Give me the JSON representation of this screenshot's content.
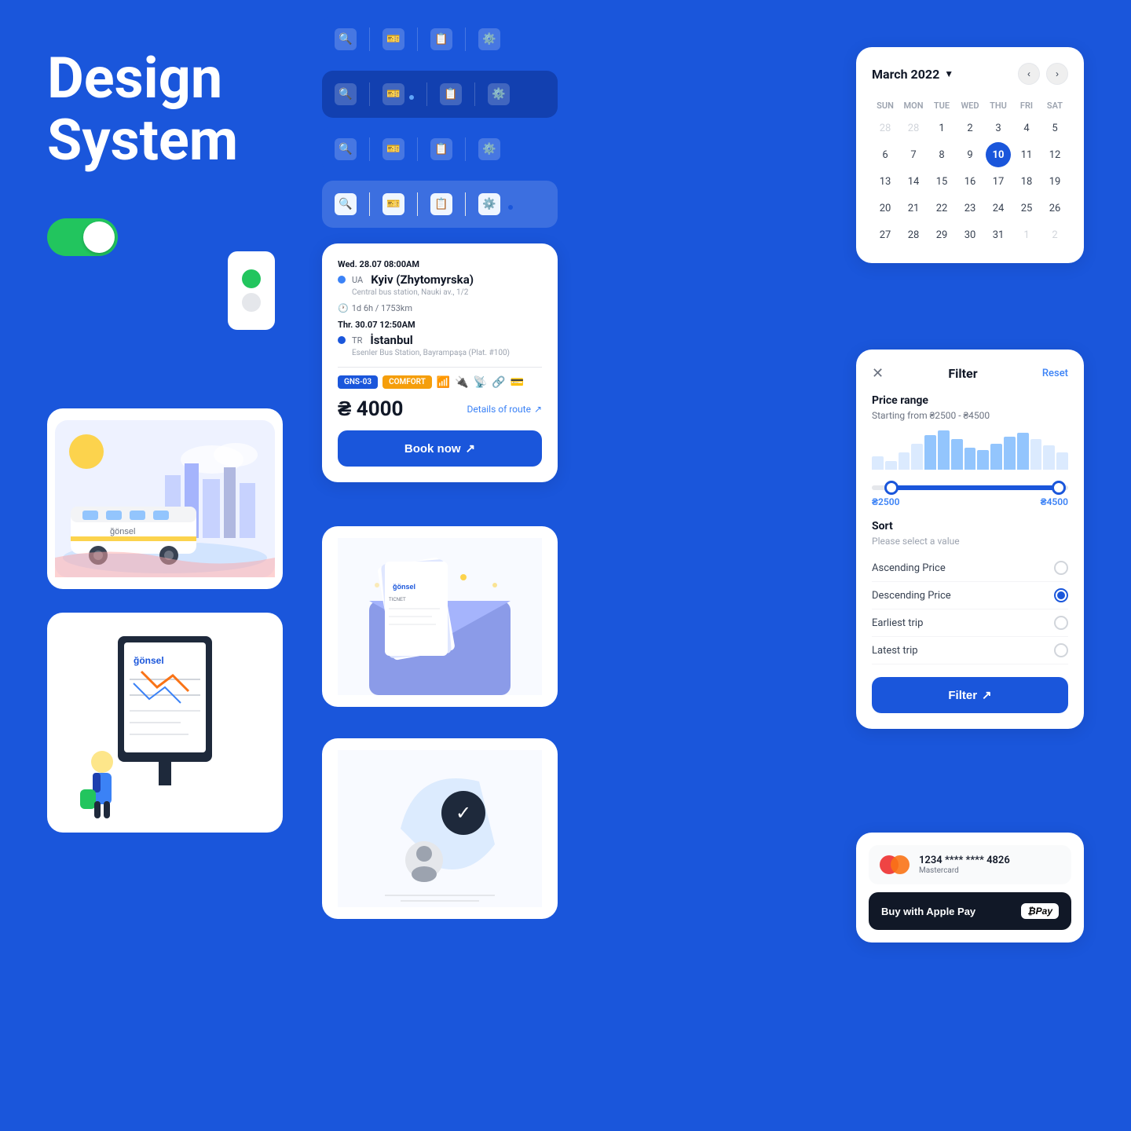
{
  "hero": {
    "title_line1": "Design",
    "title_line2": "System"
  },
  "toggle": {
    "state": "on"
  },
  "search_bars": [
    {
      "id": 1,
      "variant": "blue"
    },
    {
      "id": 2,
      "variant": "blue-active"
    },
    {
      "id": 3,
      "variant": "blue"
    },
    {
      "id": 4,
      "variant": "blue-dot"
    }
  ],
  "ticket": {
    "departure_date": "Wed. 28.07",
    "departure_time": "08:00AM",
    "origin_country": "UA",
    "origin_city": "Kyiv (Zhytomyrska)",
    "origin_address": "Central bus station, Nauki av., 1/2",
    "duration": "1d 6h / 1753km",
    "arrival_date": "Thr. 30.07",
    "arrival_time": "12:50AM",
    "dest_country": "TR",
    "dest_city": "İstanbul",
    "dest_address": "Esenler Bus Station, Bayrampaşa (Plat. #100)",
    "tag_gns": "GNS-03",
    "tag_comfort": "COMFORT",
    "price": "₴ 4000",
    "price_symbol": "₴",
    "price_amount": "4000",
    "details_label": "Details of route",
    "book_label": "Book now"
  },
  "calendar": {
    "month_label": "March 2022",
    "day_headers": [
      "SUN",
      "MON",
      "TUE",
      "WED",
      "THU",
      "FRI",
      "SAT"
    ],
    "days": [
      {
        "n": "28",
        "cls": "other-month"
      },
      {
        "n": "28",
        "cls": "other-month"
      },
      {
        "n": "1",
        "cls": ""
      },
      {
        "n": "2",
        "cls": ""
      },
      {
        "n": "3",
        "cls": ""
      },
      {
        "n": "4",
        "cls": ""
      },
      {
        "n": "5",
        "cls": ""
      },
      {
        "n": "6",
        "cls": ""
      },
      {
        "n": "7",
        "cls": ""
      },
      {
        "n": "8",
        "cls": ""
      },
      {
        "n": "9",
        "cls": ""
      },
      {
        "n": "10",
        "cls": "today"
      },
      {
        "n": "11",
        "cls": ""
      },
      {
        "n": "12",
        "cls": ""
      },
      {
        "n": "13",
        "cls": ""
      },
      {
        "n": "14",
        "cls": ""
      },
      {
        "n": "15",
        "cls": ""
      },
      {
        "n": "16",
        "cls": ""
      },
      {
        "n": "17",
        "cls": ""
      },
      {
        "n": "18",
        "cls": ""
      },
      {
        "n": "19",
        "cls": ""
      },
      {
        "n": "20",
        "cls": ""
      },
      {
        "n": "21",
        "cls": ""
      },
      {
        "n": "22",
        "cls": ""
      },
      {
        "n": "23",
        "cls": ""
      },
      {
        "n": "24",
        "cls": ""
      },
      {
        "n": "25",
        "cls": ""
      },
      {
        "n": "26",
        "cls": ""
      },
      {
        "n": "27",
        "cls": ""
      },
      {
        "n": "28",
        "cls": ""
      },
      {
        "n": "29",
        "cls": ""
      },
      {
        "n": "30",
        "cls": ""
      },
      {
        "n": "31",
        "cls": ""
      },
      {
        "n": "1",
        "cls": "other-month"
      },
      {
        "n": "2",
        "cls": "other-month"
      }
    ],
    "prev_btn": "‹",
    "next_btn": "›"
  },
  "filter": {
    "title": "Filter",
    "reset_label": "Reset",
    "price_range_title": "Price range",
    "price_range_sub": "Starting from ₴2500 - ₴4500",
    "price_min": "₴2500",
    "price_max": "₴4500",
    "sort_title": "Sort",
    "sort_sub": "Please select a value",
    "sort_options": [
      {
        "label": "Ascending Price",
        "selected": false
      },
      {
        "label": "Descending Price",
        "selected": true
      },
      {
        "label": "Earliest trip",
        "selected": false
      },
      {
        "label": "Latest trip",
        "selected": false
      }
    ],
    "filter_btn_label": "Filter",
    "price_bars": [
      30,
      20,
      40,
      60,
      80,
      90,
      70,
      50,
      45,
      60,
      75,
      85,
      70,
      55,
      40
    ]
  },
  "payment": {
    "card_number": "1234  ****  ****  4826",
    "card_brand": "Mastercard",
    "apple_pay_label": "Buy with Apple Pay",
    "apple_pay_logo": "Pay"
  }
}
